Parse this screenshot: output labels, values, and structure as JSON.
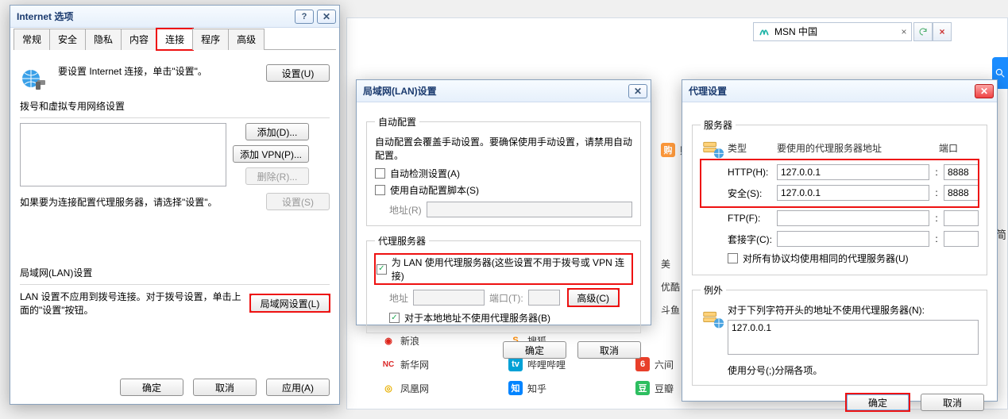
{
  "address_bar": {
    "text": "MSN 中国"
  },
  "internet_options": {
    "title": "Internet 选项",
    "tabs": [
      "常规",
      "安全",
      "隐私",
      "内容",
      "连接",
      "程序",
      "高级"
    ],
    "active_tab": "连接",
    "setup_text": "要设置 Internet 连接，单击\"设置\"。",
    "setup_btn": "设置(U)",
    "dial_group": "拨号和虚拟专用网络设置",
    "add_btn": "添加(D)...",
    "add_vpn_btn": "添加 VPN(P)...",
    "remove_btn": "删除(R)...",
    "proxy_hint": "如果要为连接配置代理服务器，请选择\"设置\"。",
    "settings_btn": "设置(S)",
    "lan_group": "局域网(LAN)设置",
    "lan_hint": "LAN 设置不应用到拨号连接。对于拨号设置，单击上面的\"设置\"按钮。",
    "lan_btn": "局域网设置(L)",
    "ok": "确定",
    "cancel": "取消",
    "apply": "应用(A)"
  },
  "lan": {
    "title": "局域网(LAN)设置",
    "auto_group": "自动配置",
    "auto_hint": "自动配置会覆盖手动设置。要确保使用手动设置，请禁用自动配置。",
    "auto_detect": "自动检测设置(A)",
    "auto_script": "使用自动配置脚本(S)",
    "addr_label": "地址(R)",
    "addr_value": "",
    "proxy_group": "代理服务器",
    "proxy_use": "为 LAN 使用代理服务器(这些设置不用于拨号或 VPN 连接)",
    "proxy_addr_label": "地址",
    "proxy_port_label": "端口(T):",
    "proxy_addr": "",
    "proxy_port": "",
    "advanced_btn": "高级(C)",
    "bypass_local": "对于本地地址不使用代理服务器(B)",
    "ok": "确定",
    "cancel": "取消"
  },
  "proxy": {
    "title": "代理设置",
    "servers_group": "服务器",
    "col_type": "类型",
    "col_host": "要使用的代理服务器地址",
    "col_port": "端口",
    "rows": {
      "http": {
        "label": "HTTP(H):",
        "host": "127.0.0.1",
        "port": "8888"
      },
      "secure": {
        "label": "安全(S):",
        "host": "127.0.0.1",
        "port": "8888"
      },
      "ftp": {
        "label": "FTP(F):",
        "host": "",
        "port": ""
      },
      "socks": {
        "label": "套接字(C):",
        "host": "",
        "port": ""
      }
    },
    "same_for_all": "对所有协议均使用相同的代理服务器(U)",
    "except_group": "例外",
    "except_label": "对于下列字符开头的地址不使用代理服务器(N):",
    "except_value": "127.0.0.1",
    "except_hint": "使用分号(;)分隔各项。",
    "ok": "确定",
    "cancel": "取消"
  },
  "bg_sites": {
    "left": [
      {
        "n": "购物",
        "c": "#ff9a3c"
      },
      {
        "n": "美",
        "c": "#e94f7a"
      },
      {
        "n": "优酷",
        "c": "#1296db"
      },
      {
        "n": "斗鱼",
        "c": "#ff7b00"
      }
    ],
    "midL": [
      {
        "n": "新浪",
        "c": "#e1251b"
      },
      {
        "n": "新华网",
        "c": "#db2828"
      },
      {
        "n": "凤凰网",
        "c": "#e8b000"
      }
    ],
    "midR": [
      {
        "n": "搜狐",
        "c": "#ff8a00"
      },
      {
        "n": "哔哩哔哩",
        "c": "#00a1d6"
      },
      {
        "n": "知乎",
        "c": "#0084ff"
      }
    ],
    "right": [
      {
        "n": "六间",
        "c": "#e83f2a"
      },
      {
        "n": "豆瓣",
        "c": "#2dbe60"
      }
    ]
  }
}
